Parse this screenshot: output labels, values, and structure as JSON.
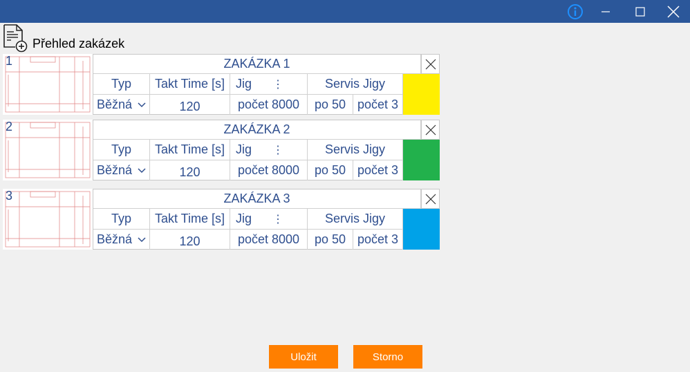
{
  "window": {
    "info_icon": "info-icon",
    "minimize_icon": "minimize-icon",
    "maximize_icon": "maximize-icon",
    "close_icon": "close-icon"
  },
  "header": {
    "title": "Přehled zakázek",
    "icon": "document-add-icon"
  },
  "orders": [
    {
      "number": "1",
      "title": "ZAKÁZKA 1",
      "typ_label": "Typ",
      "takt_label": "Takt Time [s]",
      "jig_label": "Jig",
      "jig_menu": "⋮",
      "servis_label": "Servis Jigy",
      "typ_value": "Běžná",
      "takt_value": "120",
      "jig_count": "počet  8000",
      "servis_po": "po 50",
      "servis_count": "počet 3",
      "color": "#ffef00"
    },
    {
      "number": "2",
      "title": "ZAKÁZKA 2",
      "typ_label": "Typ",
      "takt_label": "Takt Time [s]",
      "jig_label": "Jig",
      "jig_menu": "⋮",
      "servis_label": "Servis Jigy",
      "typ_value": "Běžná",
      "takt_value": "120",
      "jig_count": "počet  8000",
      "servis_po": "po 50",
      "servis_count": "počet 3",
      "color": "#22b14c"
    },
    {
      "number": "3",
      "title": "ZAKÁZKA 3",
      "typ_label": "Typ",
      "takt_label": "Takt Time [s]",
      "jig_label": "Jig",
      "jig_menu": "⋮",
      "servis_label": "Servis Jigy",
      "typ_value": "Běžná",
      "takt_value": "120",
      "jig_count": "počet  8000",
      "servis_po": "po 50",
      "servis_count": "počet 3",
      "color": "#00a2e8"
    }
  ],
  "buttons": {
    "save": "Uložit",
    "cancel": "Storno"
  },
  "colors": {
    "titlebar": "#2b579a",
    "accent_button": "#ff7f00",
    "text_blue": "#2f4f8f"
  }
}
